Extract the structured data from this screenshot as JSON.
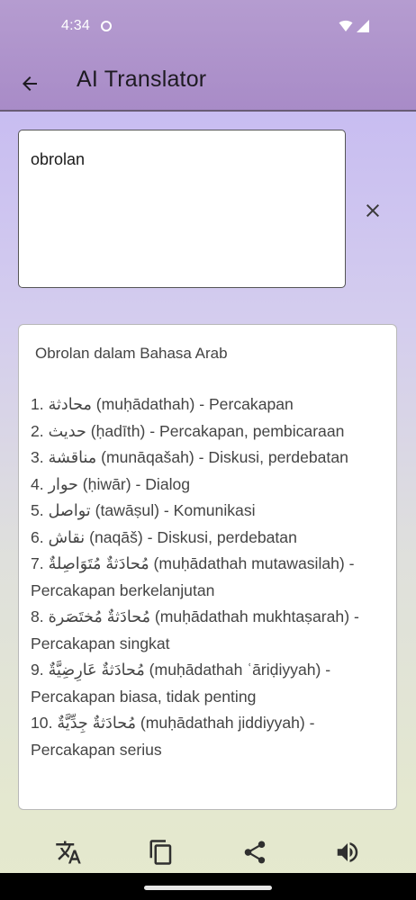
{
  "status_bar": {
    "time": "4:34"
  },
  "app_bar": {
    "title": "AI Translator"
  },
  "input": {
    "value": "obrolan"
  },
  "result": {
    "title": "Obrolan dalam Bahasa Arab",
    "items": [
      "1. محادثة (muḥādathah) - Percakapan",
      "2. حديث (ḥadīth) - Percakapan, pembicaraan",
      "3. مناقشة (munāqašah) - Diskusi, perdebatan",
      "4. حوار (ḥiwār) - Dialog",
      "5. تواصل (tawāṣul) - Komunikasi",
      "6. نقاش (naqāš) - Diskusi, perdebatan",
      "7. مُحادَثةٌ مُتَوَاصِلةٌ (muḥādathah mutawasilah) - Percakapan berkelanjutan",
      "8. مُحادَثةٌ مُختَصَرة (muḥādathah mukhtaṣarah) - Percakapan singkat",
      "9. مُحادَثةٌ عَارِضِيَّةٌ (muḥādathah ʿāriḍiyyah) - Percakapan biasa, tidak penting",
      "10. مُحادَثةٌ جِدِّيَّةٌ (muḥādathah jiddiyyah) - Percakapan serius"
    ]
  },
  "icons": {
    "back": "arrow-back-icon",
    "clear": "close-icon",
    "translate": "translate-icon",
    "copy": "copy-icon",
    "share": "share-icon",
    "speak": "volume-icon"
  }
}
